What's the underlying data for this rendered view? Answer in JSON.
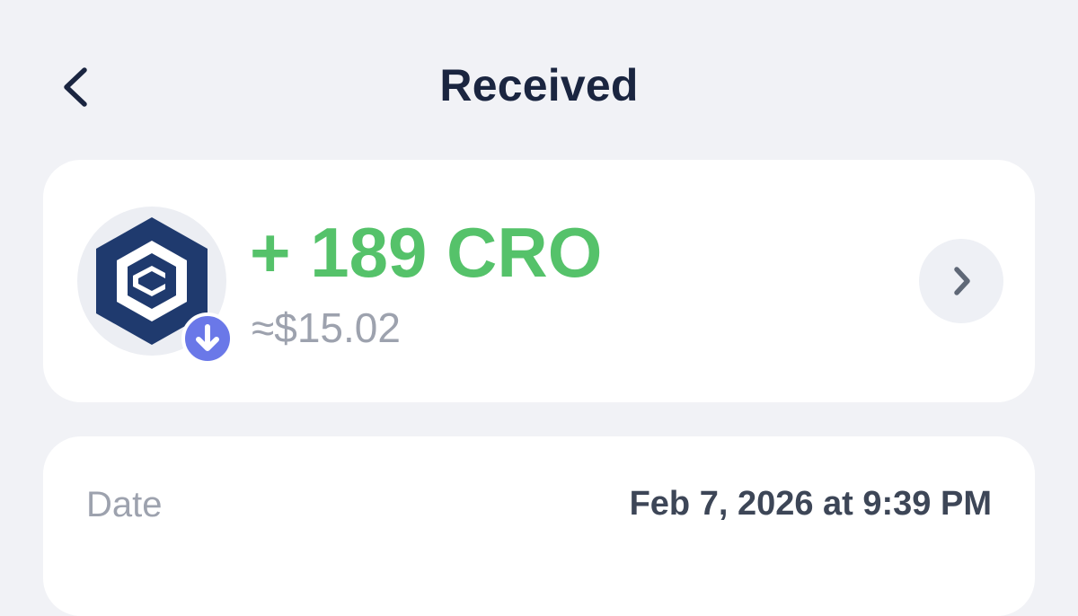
{
  "header": {
    "title": "Received",
    "back_icon": "chevron-left-icon"
  },
  "transaction": {
    "amount": "+ 189 CRO",
    "fiat_value": "≈$15.02",
    "token_icon": "cronos-logo-icon",
    "direction_icon": "arrow-down-icon",
    "details_icon": "chevron-right-icon"
  },
  "details": {
    "date_label": "Date",
    "date_value": "Feb 7, 2026 at 9:39 PM"
  },
  "colors": {
    "background": "#f1f2f6",
    "card": "#ffffff",
    "title": "#1a2540",
    "amount_positive": "#55c26a",
    "muted_text": "#9da2ae",
    "badge": "#6a78e8",
    "logo": "#1f3a6e"
  }
}
